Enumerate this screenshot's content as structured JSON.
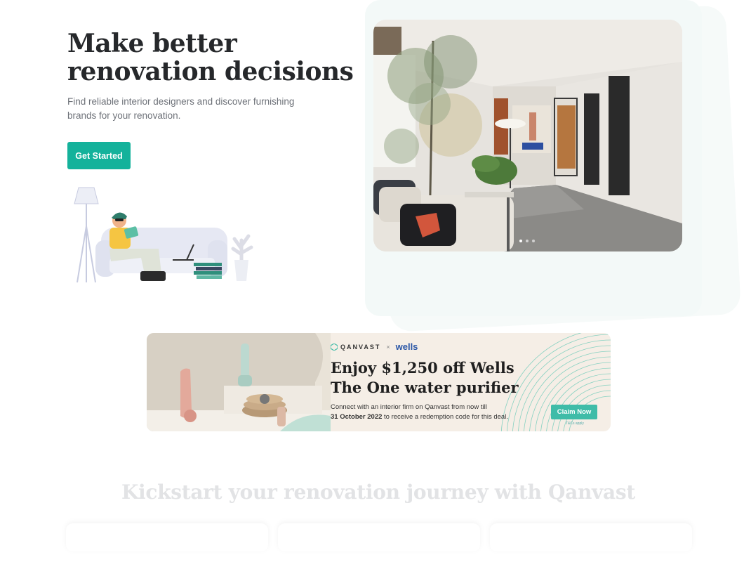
{
  "hero": {
    "title_line1": "Make better",
    "title_line2": "renovation decisions",
    "subtitle": "Find reliable interior designers and discover furnishing brands for your renovation.",
    "cta_label": "Get Started"
  },
  "promo": {
    "brand_left": "QANVAST",
    "times": "×",
    "brand_right": "wells",
    "headline_line1": "Enjoy $1,250 off Wells",
    "headline_line2": "The One water purifier",
    "copy_pre": "Connect with an interior firm on Qanvast from now till",
    "copy_date": "31 October 2022",
    "copy_post": "to receive a redemption code for this deal.",
    "button_label": "Claim Now",
    "tnc": "T&Cs apply"
  },
  "carousel": {
    "slide_count": 3,
    "active_index": 0
  },
  "section": {
    "title": "Kickstart your renovation journey with Qanvast"
  },
  "colors": {
    "accent": "#14b29b",
    "promo_bg": "#f5eee6",
    "promo_button": "#3fbca8",
    "wells_blue": "#2a56a6"
  }
}
